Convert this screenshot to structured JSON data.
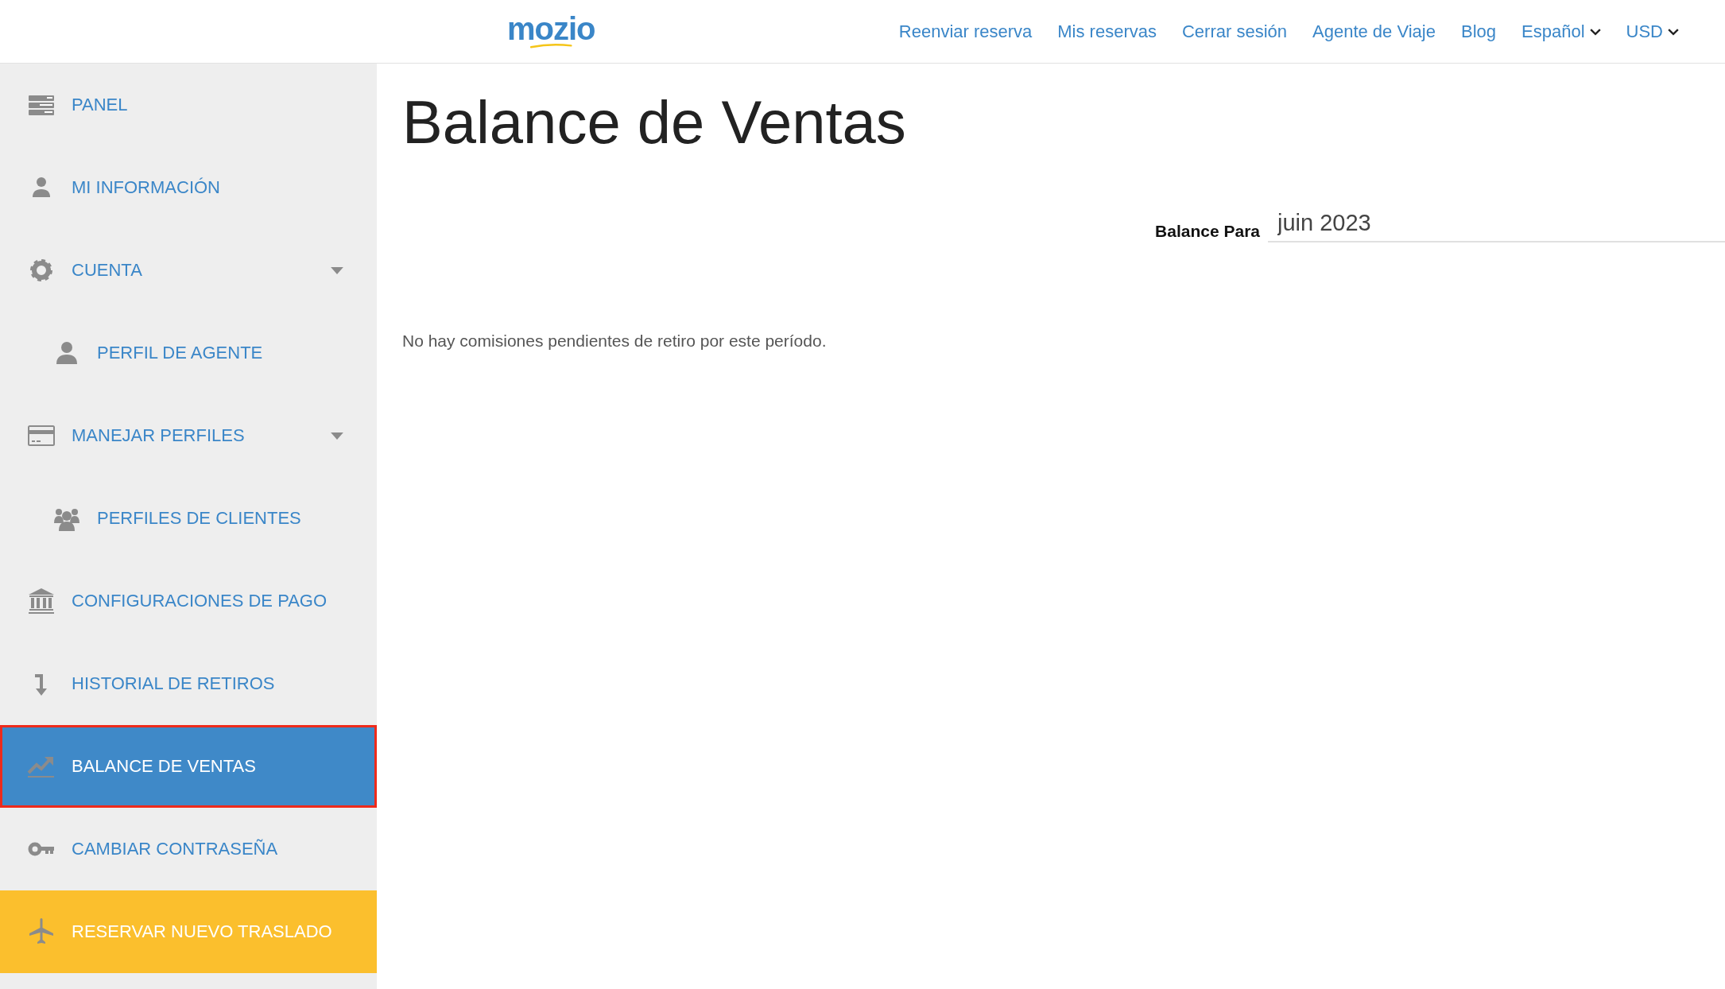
{
  "header": {
    "logo": "mozio",
    "nav": [
      {
        "label": "Reenviar reserva",
        "kind": "link"
      },
      {
        "label": "Mis reservas",
        "kind": "link"
      },
      {
        "label": "Cerrar sesión",
        "kind": "link"
      },
      {
        "label": "Agente de Viaje",
        "kind": "link"
      },
      {
        "label": "Blog",
        "kind": "link"
      },
      {
        "label": "Español",
        "kind": "dropdown"
      },
      {
        "label": "USD",
        "kind": "dropdown"
      }
    ]
  },
  "sidebar": {
    "items": [
      {
        "label": "PANEL",
        "kind": "item",
        "selected": false
      },
      {
        "label": "MI INFORMACIÓN",
        "kind": "item",
        "selected": false
      },
      {
        "label": "CUENTA",
        "kind": "item",
        "selected": false,
        "expanded": true,
        "children": [
          {
            "label": "PERFIL DE AGENTE",
            "selected": false
          }
        ]
      },
      {
        "label": "MANEJAR PERFILES",
        "kind": "item",
        "selected": false,
        "expanded": true,
        "children": [
          {
            "label": "PERFILES DE CLIENTES",
            "selected": false
          }
        ]
      },
      {
        "label": "CONFIGURACIONES DE PAGO",
        "kind": "item",
        "selected": false
      },
      {
        "label": "HISTORIAL DE RETIROS",
        "kind": "item",
        "selected": false
      },
      {
        "label": "BALANCE DE VENTAS",
        "kind": "item",
        "selected": true
      },
      {
        "label": "CAMBIAR CONTRASEÑA",
        "kind": "item",
        "selected": false
      },
      {
        "label": "RESERVAR NUEVO TRASLADO",
        "kind": "action",
        "selected": false
      }
    ]
  },
  "main": {
    "title": "Balance de Ventas",
    "balance_field": {
      "label": "Balance Para",
      "value": "juin 2023"
    },
    "message": "No hay comisiones pendientes de retiro por este período."
  }
}
